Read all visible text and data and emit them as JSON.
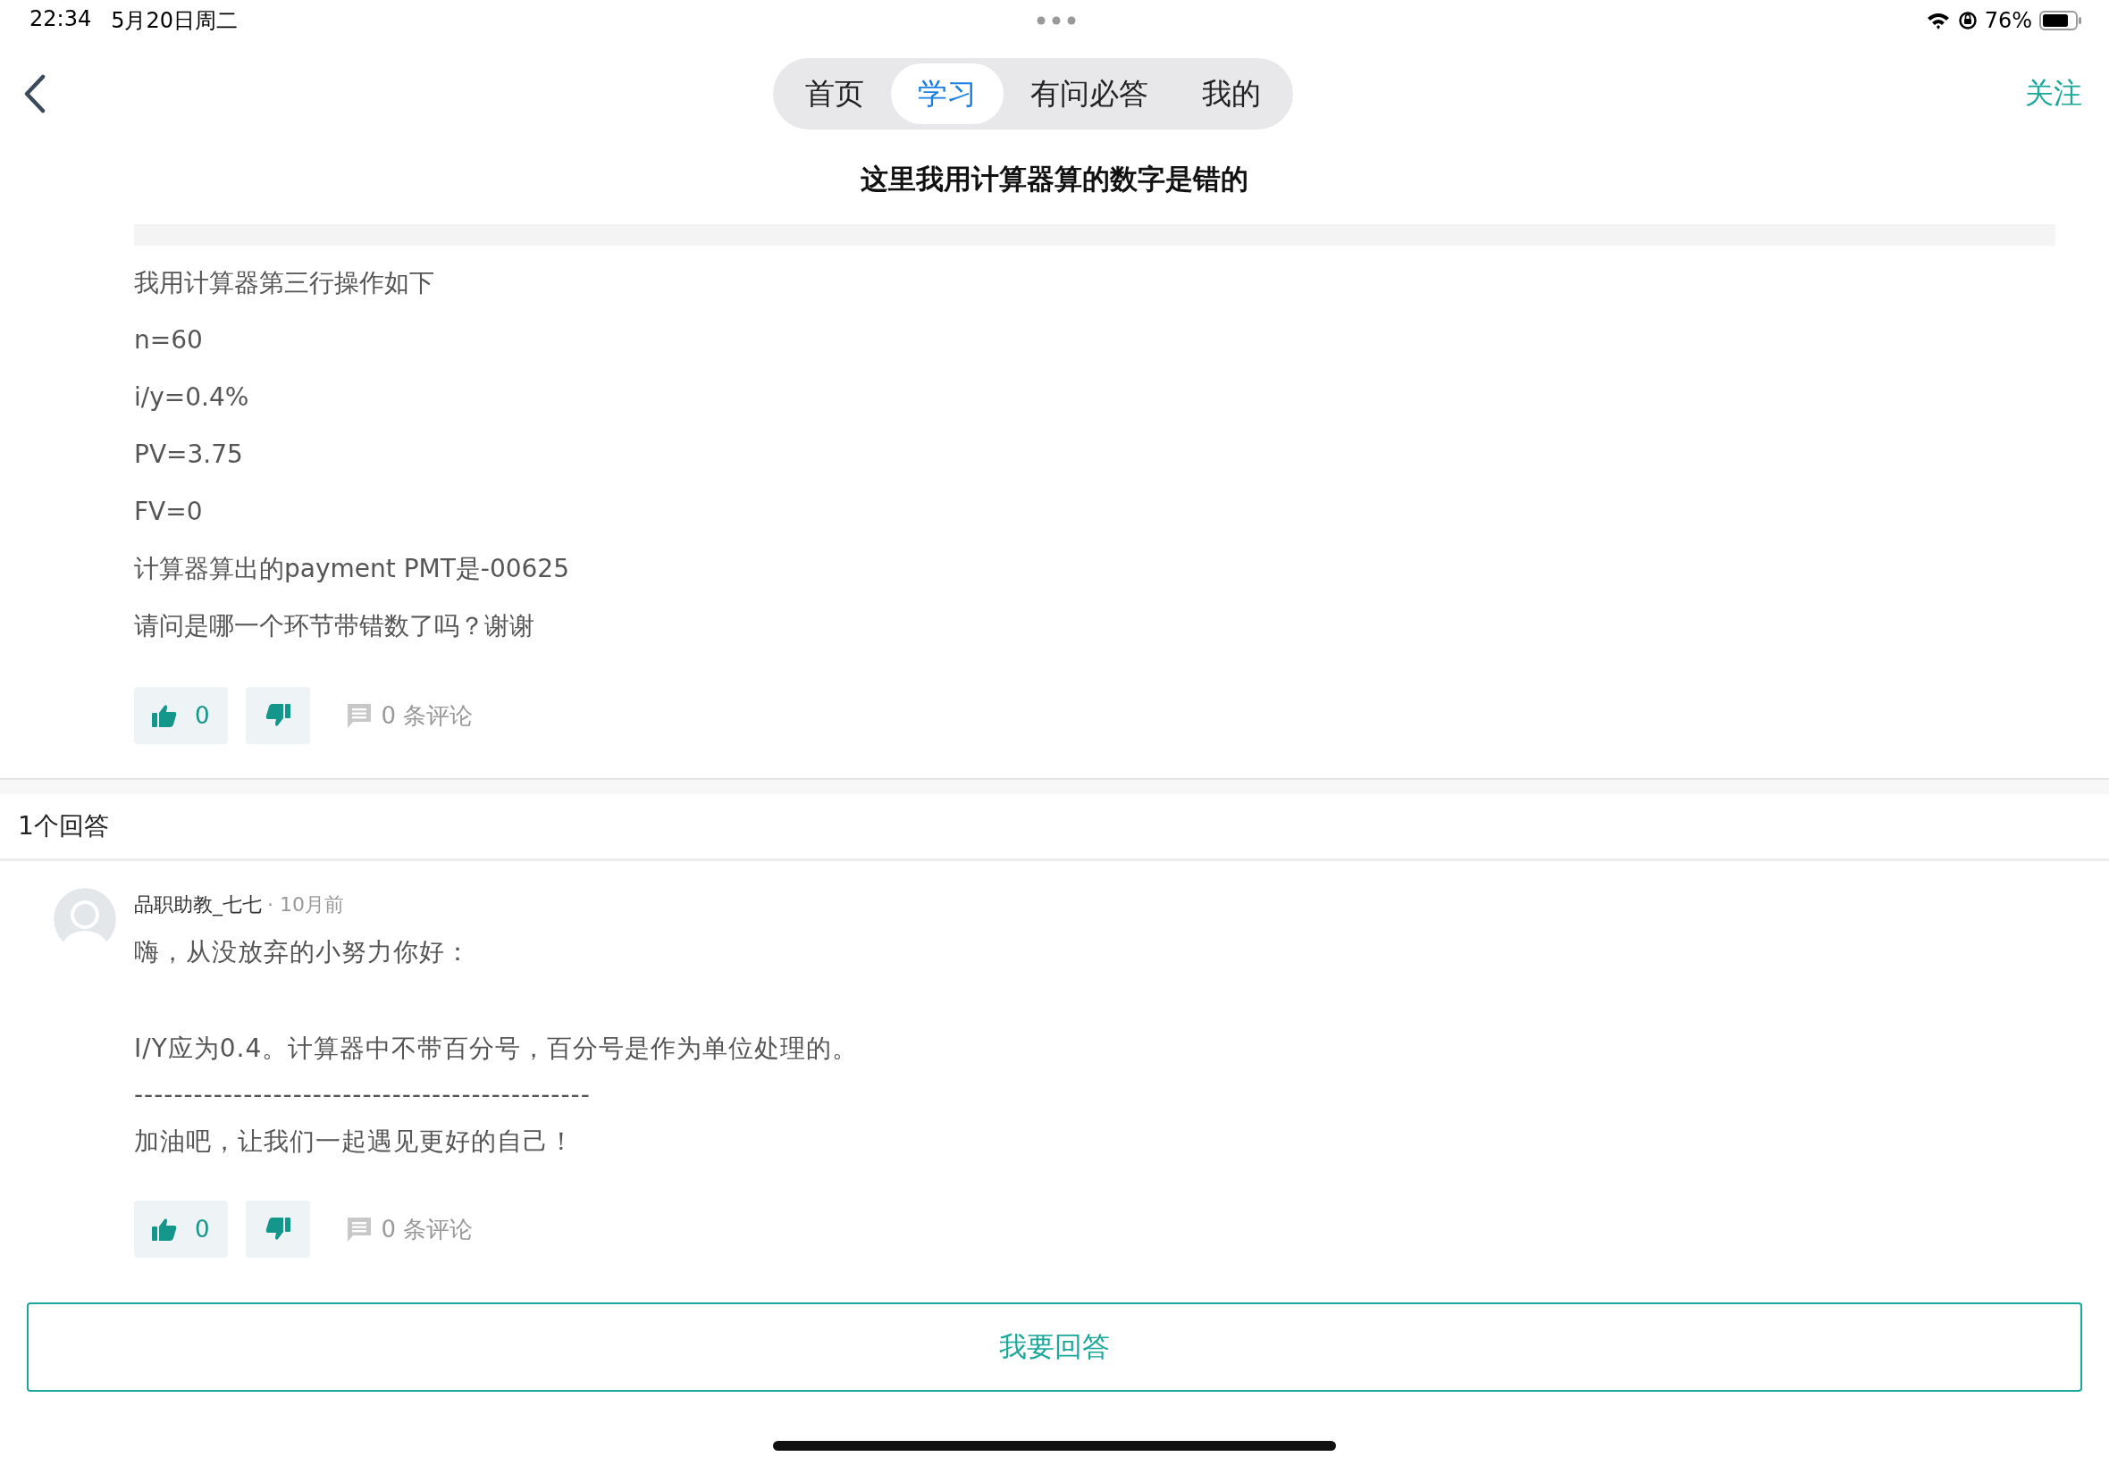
{
  "status_bar": {
    "time": "22:34",
    "date": "5月20日周二",
    "battery": "76%"
  },
  "nav": {
    "tabs": [
      {
        "label": "首页",
        "selected": false
      },
      {
        "label": "学习",
        "selected": true
      },
      {
        "label": "有问必答",
        "selected": false
      },
      {
        "label": "我的",
        "selected": false
      }
    ],
    "follow": "关注"
  },
  "question": {
    "title": "这里我用计算器算的数字是错的",
    "lines": [
      "我用计算器第三行操作如下",
      "n=60",
      "i/y=0.4%",
      "PV=3.75",
      "FV=0",
      "计算器算出的payment PMT是-00625",
      "请问是哪一个环节带错数了吗？谢谢"
    ],
    "likes": "0",
    "comments": "0 条评论"
  },
  "answers_header": "1个回答",
  "answers": [
    {
      "author": "品职助教_七七",
      "time": "· 10月前",
      "paragraphs": [
        [
          "嗨，从没放弃的小努力你好："
        ],
        [
          "I/Y应为0.4。计算器中不带百分号，百分号是作为单位处理的。",
          "----------------------------------------------",
          "加油吧，让我们一起遇见更好的自己！"
        ]
      ],
      "likes": "0",
      "comments": "0 条评论"
    }
  ],
  "answer_button": "我要回答"
}
